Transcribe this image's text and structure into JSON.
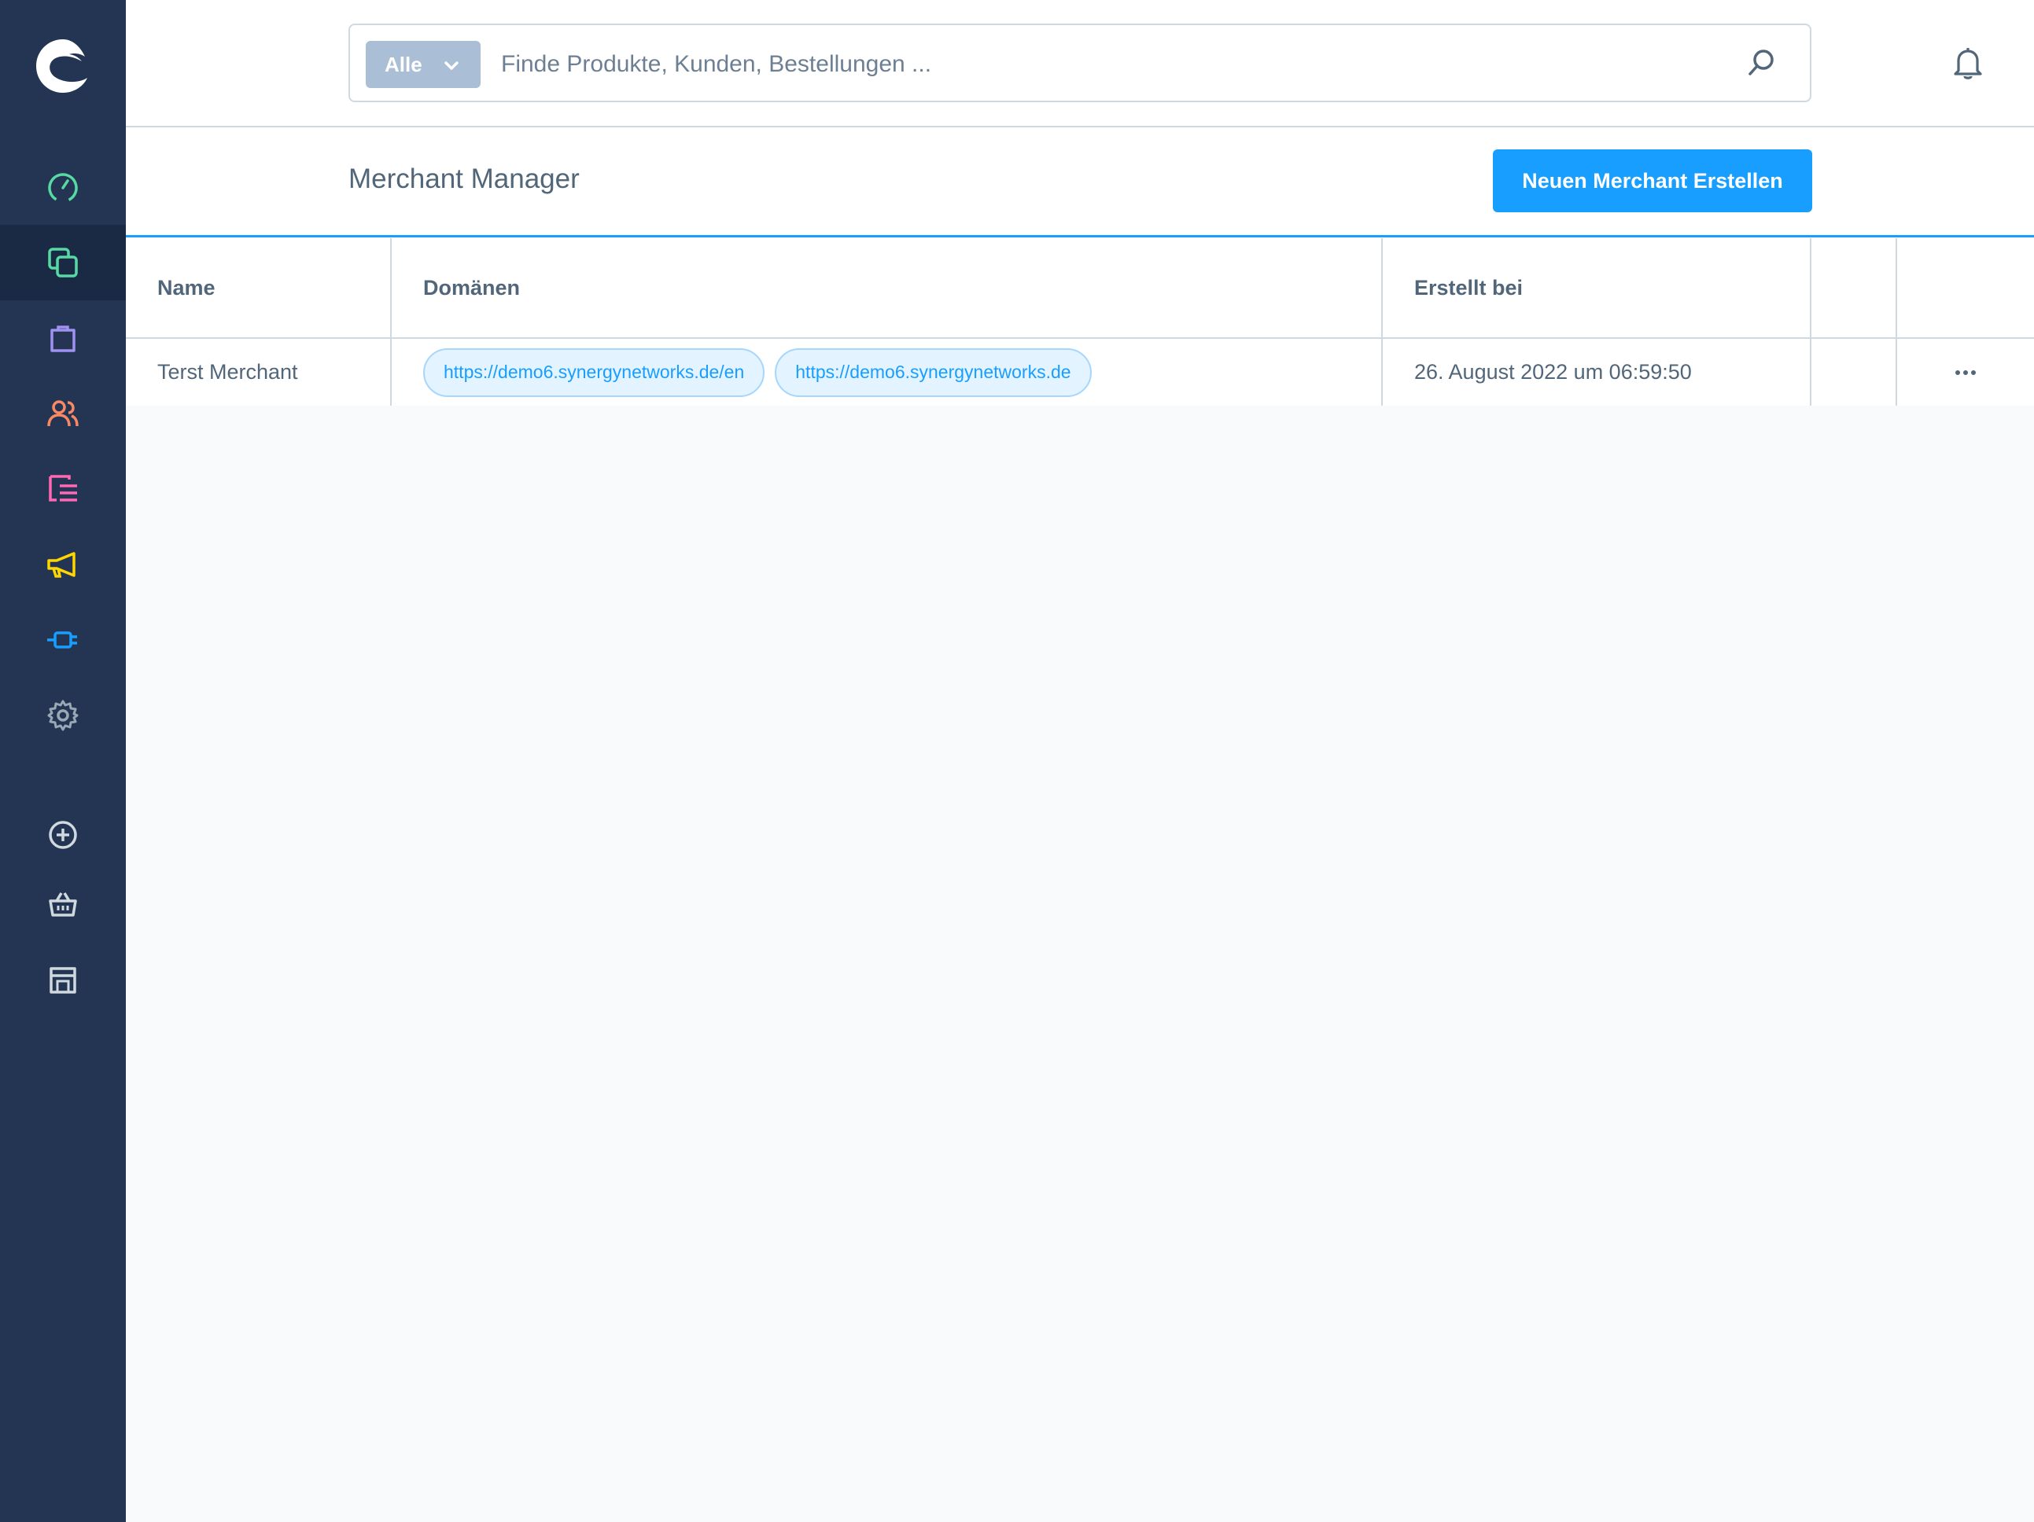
{
  "topbar": {
    "search_type": "Alle",
    "search_placeholder": "Finde Produkte, Kunden, Bestellungen ..."
  },
  "page": {
    "title": "Merchant Manager",
    "create_button": "Neuen Merchant Erstellen"
  },
  "table": {
    "columns": [
      "Name",
      "Domänen",
      "Erstellt bei"
    ],
    "rows": [
      {
        "name": "Terst Merchant",
        "domains": [
          "https://demo6.synergynetworks.de/en",
          "https://demo6.synergynetworks.de"
        ],
        "created": "26. August 2022 um 06:59:50"
      }
    ]
  },
  "sidebar": {
    "items": [
      {
        "icon": "dashboard-icon",
        "color": "#57d9a3"
      },
      {
        "icon": "catalogues-icon",
        "color": "#57d9a3",
        "active": true
      },
      {
        "icon": "orders-icon",
        "color": "#a092f0"
      },
      {
        "icon": "customers-icon",
        "color": "#f88962"
      },
      {
        "icon": "content-icon",
        "color": "#ff68b4"
      },
      {
        "icon": "marketing-icon",
        "color": "#ffd700"
      },
      {
        "icon": "extensions-icon",
        "color": "#189eff"
      },
      {
        "icon": "settings-icon",
        "color": "#9aa8b5"
      },
      {
        "icon": "add-sales-channel-icon",
        "color": "#d1d9e0"
      },
      {
        "icon": "storefront-icon",
        "color": "#d1d9e0"
      },
      {
        "icon": "headless-icon",
        "color": "#d1d9e0"
      }
    ]
  },
  "colors": {
    "sidebar_bg": "#243554",
    "accent": "#189eff",
    "text": "#52667a"
  }
}
